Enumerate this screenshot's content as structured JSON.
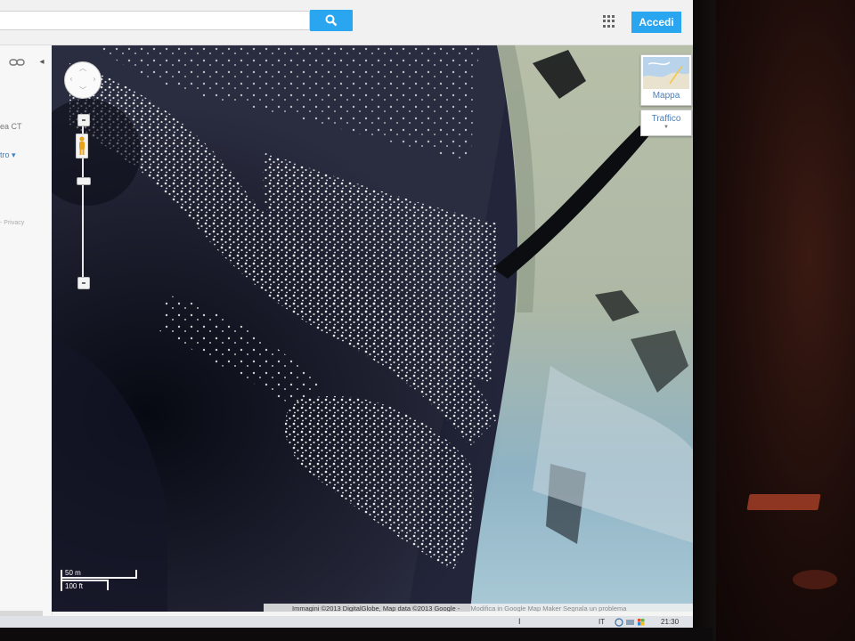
{
  "header": {
    "search_placeholder": "",
    "signin_label": "Accedi",
    "accent_color": "#2aa5f0",
    "icons": [
      "search-icon",
      "apps-grid-icon"
    ]
  },
  "left_panel": {
    "text_1": "ea CT",
    "link": "tro ▾",
    "privacy": "- Privacy",
    "icons": [
      "link-icon",
      "collapse-icon"
    ]
  },
  "map": {
    "view": "satellite",
    "controls": {
      "pan": "pan-control",
      "zoom": [
        "zoom-in",
        "zoom-out"
      ],
      "street_view": "pegman-icon"
    },
    "map_type_label": "Mappa",
    "traffic_label": "Traffico",
    "scale": {
      "metric": "50 m",
      "imperial": "100 ft"
    },
    "attribution": "Immagini ©2013 DigitalGlobe, Map data ©2013 Google -",
    "attribution_links": "Modifica in Google Map Maker    Segnala un problema"
  },
  "taskbar": {
    "language": "IT",
    "time": "21:30"
  }
}
